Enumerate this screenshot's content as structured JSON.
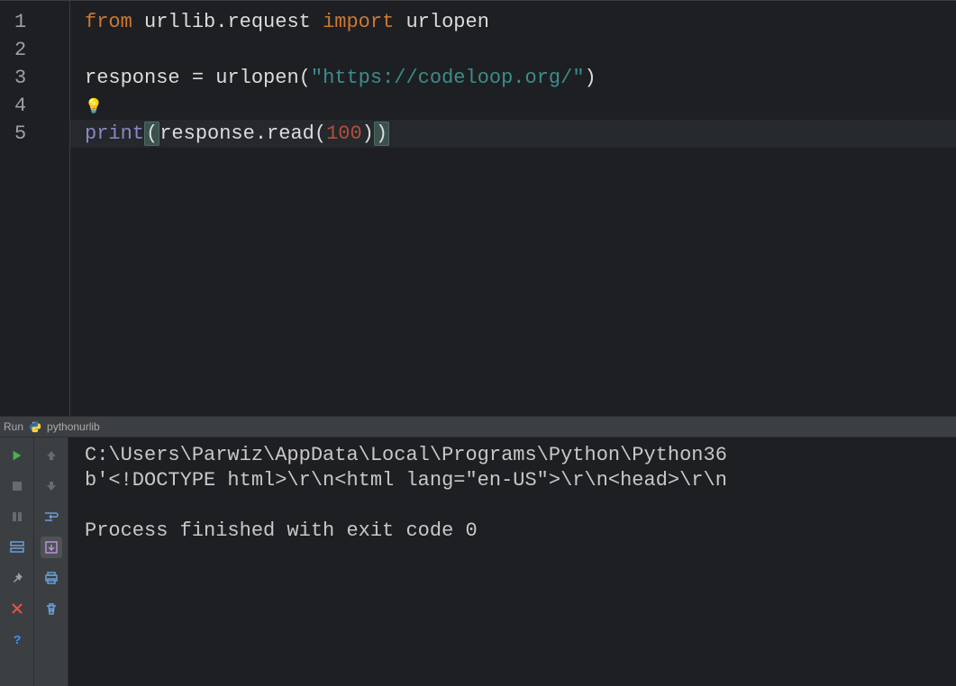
{
  "editor": {
    "lineNumbers": [
      "1",
      "2",
      "3",
      "4",
      "5"
    ],
    "line1": {
      "kw1": "from",
      "mod": "urllib",
      "dot": ".",
      "sub": "request",
      "kw2": "import",
      "func": "urlopen"
    },
    "line3": {
      "var": "response",
      "eq": "=",
      "call": "urlopen",
      "strq1": "\"",
      "str": "https://codeloop.org/",
      "strq2": "\""
    },
    "line4": {
      "bulb": "💡"
    },
    "line5": {
      "print": "print",
      "respread": "response",
      "dot": ".",
      "read": "read",
      "num": "100"
    }
  },
  "runbar": {
    "label": "Run",
    "config": "pythonurlib"
  },
  "console": {
    "path": "C:\\Users\\Parwiz\\AppData\\Local\\Programs\\Python\\Python36",
    "out": "b'<!DOCTYPE html>\\r\\n<html lang=\"en-US\">\\r\\n<head>\\r\\n",
    "exit": "Process finished with exit code 0"
  },
  "icons": {
    "run": "run-icon",
    "stop": "stop-icon",
    "pause": "pause-icon",
    "layout": "layout-icon",
    "pin": "pin-icon",
    "close": "close-icon",
    "help": "help-icon",
    "up": "arrow-up-icon",
    "down": "arrow-down-icon",
    "wrap": "wrap-icon",
    "scroll": "scroll-icon",
    "print": "print-icon",
    "trash": "trash-icon"
  }
}
